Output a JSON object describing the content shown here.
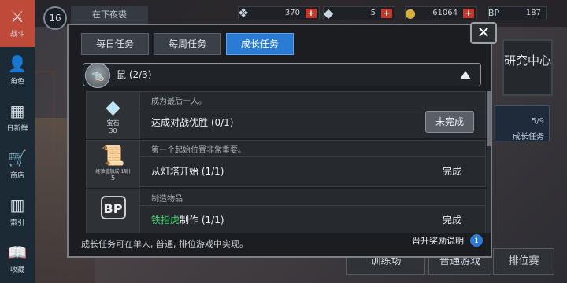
{
  "topbar": {
    "level": "16",
    "player_name": "在下夜裘",
    "resources": [
      {
        "icon": "feather-icon",
        "value": "370"
      },
      {
        "icon": "book-icon",
        "value": "5"
      },
      {
        "icon": "coin-icon",
        "value": "61064"
      },
      {
        "icon": "bp-icon",
        "value": "187"
      }
    ]
  },
  "leftnav": [
    {
      "label": "战斗",
      "icon": "crossed-swords-icon",
      "active": true
    },
    {
      "label": "角色",
      "icon": "person-icon",
      "active": false
    },
    {
      "label": "日新鲜",
      "icon": "calendar-icon",
      "active": false
    },
    {
      "label": "商店",
      "icon": "cart-icon",
      "active": false
    },
    {
      "label": "索引",
      "icon": "books-icon",
      "active": false
    },
    {
      "label": "收藏",
      "icon": "open-book-icon",
      "active": false
    }
  ],
  "right": {
    "research_label": "研究中心",
    "growth_count": "5/9",
    "growth_label": "成长任务"
  },
  "bottom_buttons": [
    "训练场",
    "普通游戏",
    "排位赛"
  ],
  "modal": {
    "tabs": [
      {
        "label": "每日任务",
        "active": false
      },
      {
        "label": "每周任务",
        "active": false
      },
      {
        "label": "成长任务",
        "active": true
      }
    ],
    "close_label": "✕",
    "dropdown_label": "鼠 (2/3)",
    "tasks": [
      {
        "reward_icon": "gem-icon",
        "reward_name": "宝石",
        "reward_qty": "30",
        "description": "成为最后一人。",
        "title": "达成对战优胜 (0/1)",
        "status": "未完成",
        "completed": false
      },
      {
        "reward_icon": "scroll-icon",
        "reward_name": "经验值加成(1局)",
        "reward_qty": "5",
        "description": "第一个起始位置非常重要。",
        "title": "从灯塔开始 (1/1)",
        "status": "完成",
        "completed": true
      },
      {
        "reward_icon": "bp-icon",
        "reward_name": "",
        "reward_qty": "",
        "description": "制造物品",
        "title_highlight": "铁指虎",
        "title_rest": "制作 (1/1)",
        "status": "完成",
        "completed": true
      }
    ],
    "footer_note": "成长任务可在单人, 普通, 排位游戏中实现。",
    "footer_link": "晋升奖励说明",
    "info_glyph": "i"
  }
}
